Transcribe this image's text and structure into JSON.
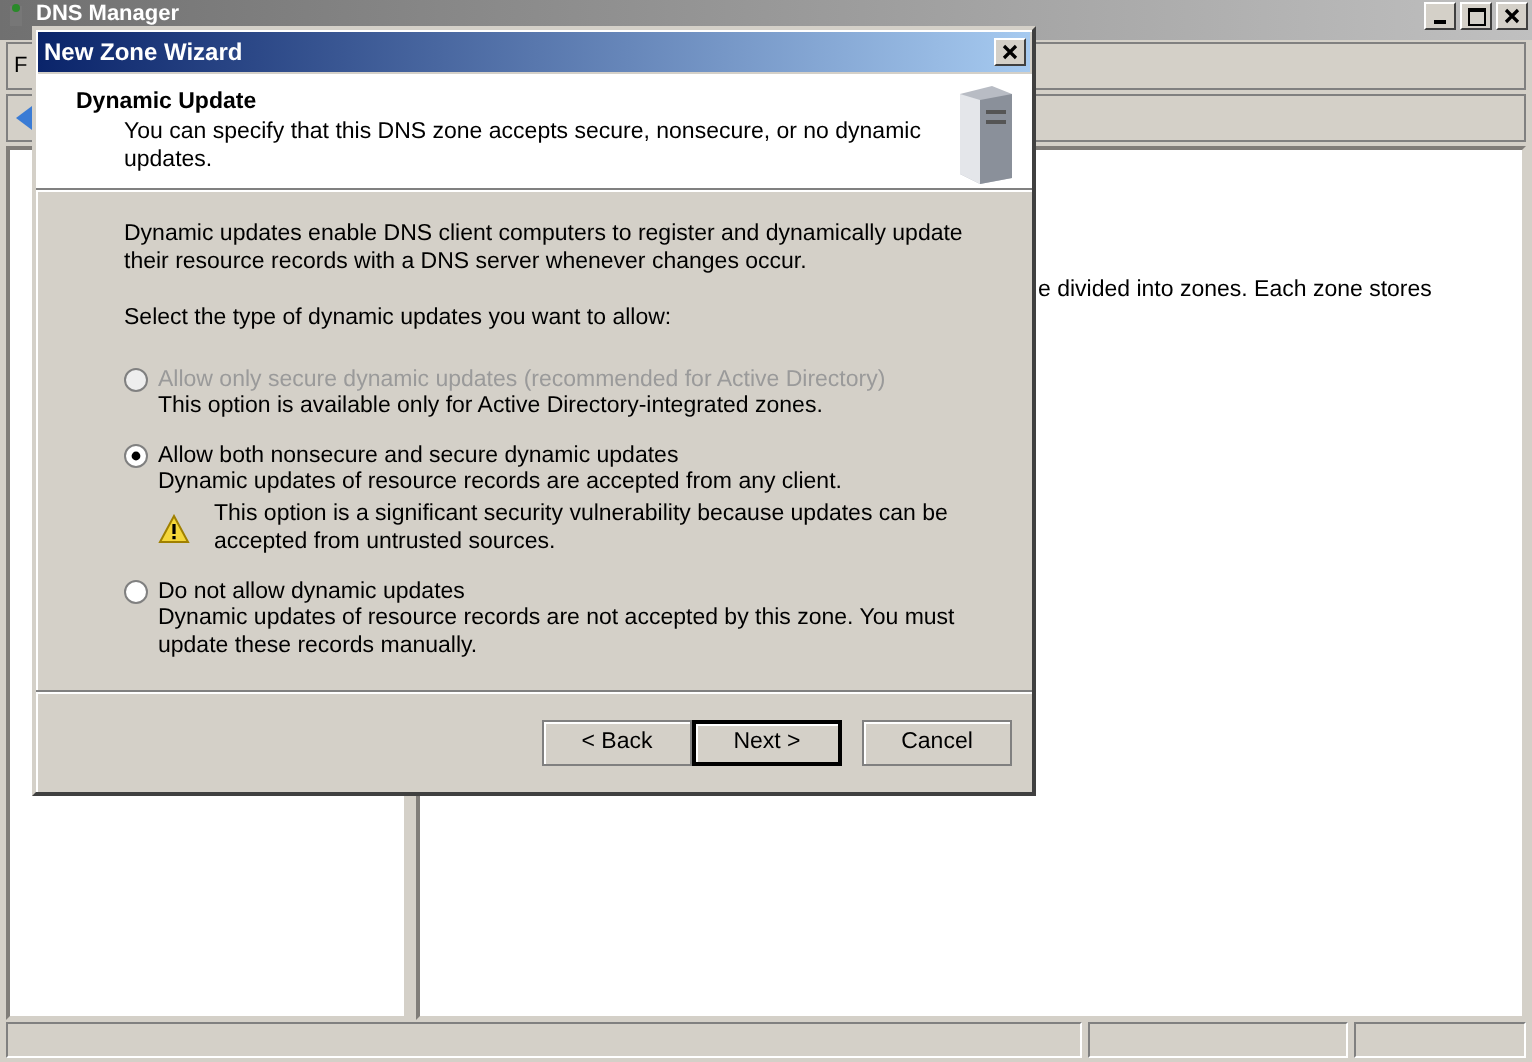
{
  "main_window": {
    "title": "DNS Manager",
    "menu": [
      "F"
    ],
    "details_text": "e divided into zones. Each zone stores"
  },
  "dialog": {
    "title": "New Zone Wizard",
    "header": {
      "title": "Dynamic Update",
      "subtitle": "You can specify that this DNS zone accepts secure, nonsecure, or no dynamic updates."
    },
    "intro": "Dynamic updates enable DNS client computers to register and dynamically update their resource records with a DNS server whenever changes occur.",
    "prompt": "Select the type of dynamic updates you want to allow:",
    "options": [
      {
        "label": "Allow only secure dynamic updates (recommended for Active Directory)",
        "description": "This option is available only for Active Directory-integrated zones.",
        "selected": false,
        "disabled": true
      },
      {
        "label": "Allow both nonsecure and secure dynamic updates",
        "description": "Dynamic updates of resource records are accepted from any client.",
        "warning": "This option is a significant security vulnerability because updates can be accepted from untrusted sources.",
        "selected": true,
        "disabled": false
      },
      {
        "label": "Do not allow dynamic updates",
        "description": "Dynamic updates of resource records are not accepted by this zone. You must update these records manually.",
        "selected": false,
        "disabled": false
      }
    ],
    "buttons": [
      {
        "label": "< Back",
        "default": false
      },
      {
        "label": "Next >",
        "default": true
      },
      {
        "label": "Cancel",
        "default": false
      }
    ]
  }
}
